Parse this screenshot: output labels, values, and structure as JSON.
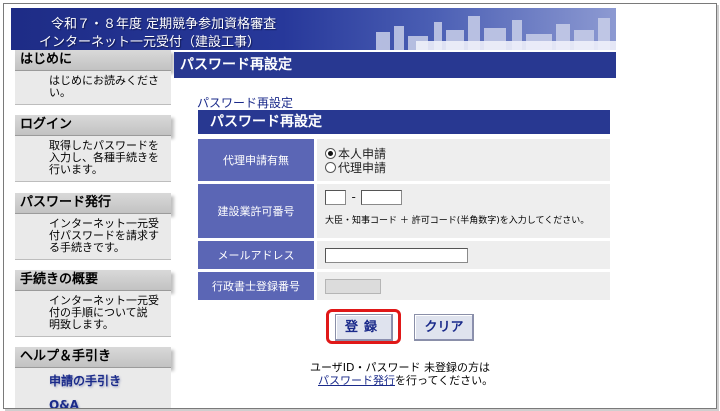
{
  "header": {
    "line1": "令和７・８年度 定期競争参加資格審査",
    "line2": "インターネット一元受付（建設工事）"
  },
  "sidebar": {
    "sections": [
      {
        "title": "はじめに",
        "lines": [
          "はじめにお読みくださ",
          "い。"
        ]
      },
      {
        "title": "ログイン",
        "lines": [
          "取得したパスワードを",
          "入力し、各種手続きを",
          "行います。"
        ]
      },
      {
        "title": "パスワード発行",
        "lines": [
          "インターネット一元受",
          "付パスワードを請求す",
          "る手続きです。"
        ]
      },
      {
        "title": "手続きの概要",
        "lines": [
          "インターネット一元受",
          "付の手順について説",
          "明致します。"
        ]
      },
      {
        "title": "ヘルプ＆手引き",
        "links": [
          "申請の手引き",
          "Q&A"
        ]
      }
    ]
  },
  "main": {
    "page_title": "パスワード再設定",
    "breadcrumb": "パスワード再設定",
    "form_title": "パスワード再設定",
    "fields": {
      "agent": {
        "label": "代理申請有無",
        "options": [
          "本人申請",
          "代理申請"
        ],
        "selected": "本人申請"
      },
      "license": {
        "label": "建設業許可番号",
        "separator": "-",
        "value1": "",
        "value2": "",
        "note": "大臣・知事コード ＋ 許可コード(半角数字)を入力してください。"
      },
      "email": {
        "label": "メールアドレス",
        "value": ""
      },
      "scrivener": {
        "label": "行政書士登録番号",
        "value": ""
      }
    },
    "buttons": {
      "register": "登録",
      "clear": "クリア"
    },
    "footer": {
      "line1": "ユーザID・パスワード 未登録の方は",
      "link": "パスワード発行",
      "line2_rest": "を行ってください。"
    }
  },
  "colors": {
    "nav_blue": "#283891",
    "label_blue": "#5b66b5",
    "highlight": "#e01818"
  }
}
